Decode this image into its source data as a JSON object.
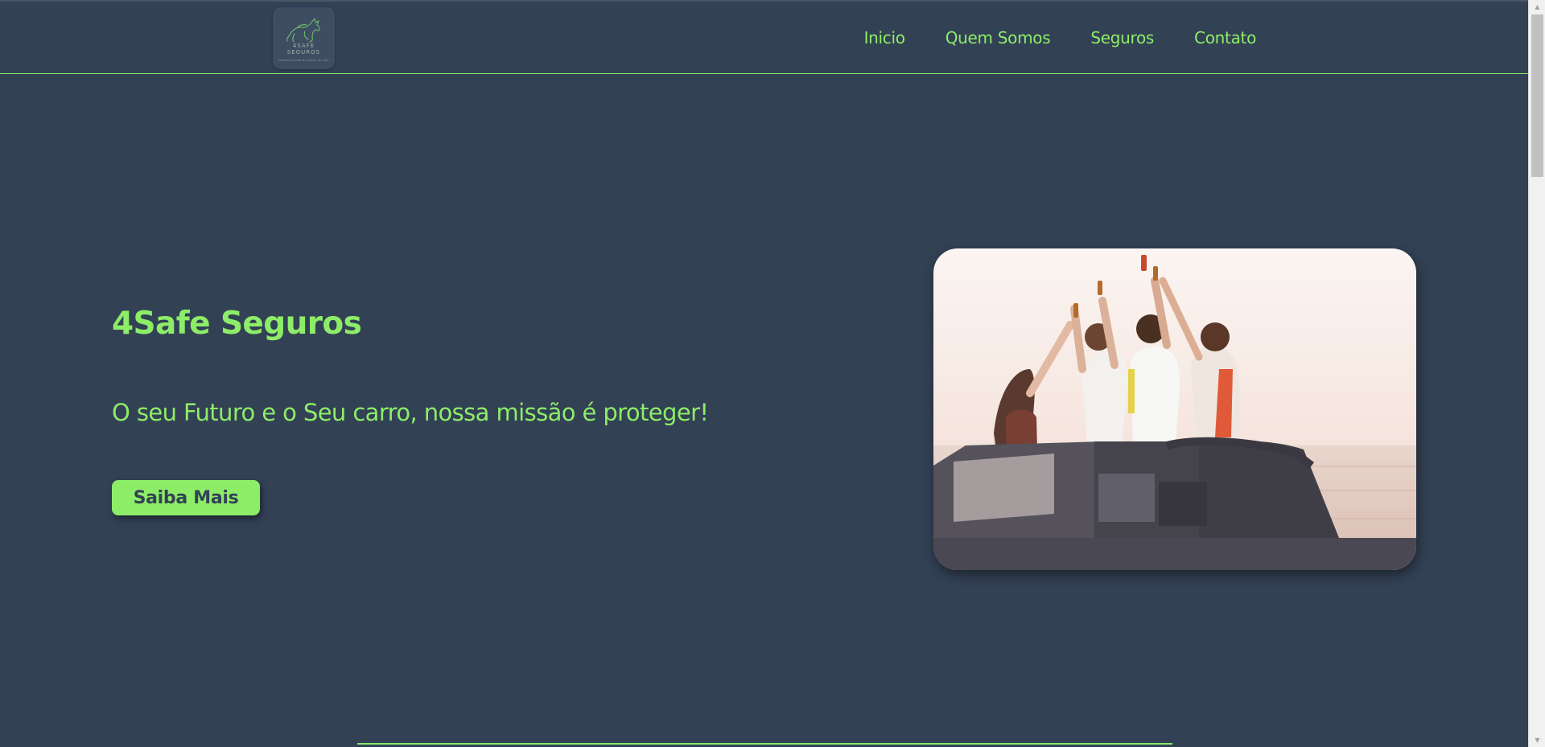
{
  "logo": {
    "name_line1": "4SAFE",
    "name_line2": "SEGUROS",
    "tagline": "TRANQUILIDADE NA PALMA DA MÃO"
  },
  "nav": {
    "items": [
      {
        "label": "Inicio"
      },
      {
        "label": "Quem Somos"
      },
      {
        "label": "Seguros"
      },
      {
        "label": "Contato"
      }
    ]
  },
  "hero": {
    "title": "4Safe Seguros",
    "subtitle": "O seu Futuro e o Seu carro, nossa missão é proteger!",
    "cta_label": "Saiba Mais"
  },
  "colors": {
    "background": "#334155",
    "accent": "#8ded68"
  },
  "scrollbar": {
    "up_arrow": "▲",
    "down_arrow": "▼"
  }
}
